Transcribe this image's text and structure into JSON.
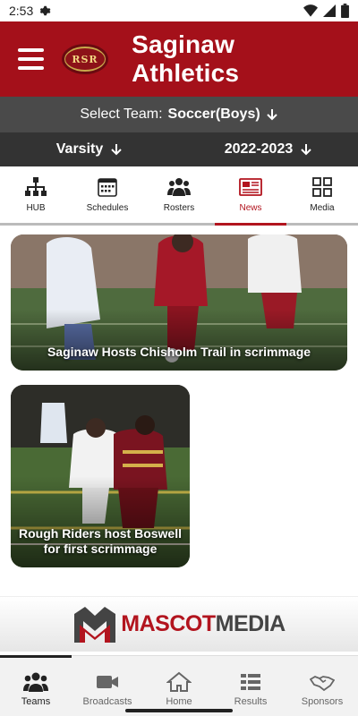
{
  "status_bar": {
    "time": "2:53"
  },
  "header": {
    "title": "Saginaw Athletics",
    "logo_text": "RSR"
  },
  "team_select": {
    "label": "Select Team:",
    "value": "Soccer(Boys)"
  },
  "level_select": {
    "level": "Varsity",
    "season": "2022-2023"
  },
  "tabs": [
    {
      "label": "HUB",
      "icon": "org-chart-icon"
    },
    {
      "label": "Schedules",
      "icon": "calendar-icon"
    },
    {
      "label": "Rosters",
      "icon": "people-icon"
    },
    {
      "label": "News",
      "icon": "newspaper-icon",
      "active": true
    },
    {
      "label": "Media",
      "icon": "grid-icon"
    }
  ],
  "news": [
    {
      "title": "Saginaw Hosts Chisholm Trail in scrimmage"
    },
    {
      "title": "Rough Riders host Boswell for first scrimmage"
    }
  ],
  "sponsor": {
    "name_part1": "MASCOT",
    "name_part2": "MEDIA"
  },
  "bottom_nav": [
    {
      "label": "Teams",
      "icon": "people-icon",
      "active": true
    },
    {
      "label": "Broadcasts",
      "icon": "video-camera-icon"
    },
    {
      "label": "Home",
      "icon": "home-icon"
    },
    {
      "label": "Results",
      "icon": "list-icon"
    },
    {
      "label": "Sponsors",
      "icon": "handshake-icon"
    }
  ],
  "colors": {
    "brand_red": "#a4101a",
    "accent_red": "#b2141e",
    "dark_gray": "#333333",
    "mid_gray": "#4a4a4a"
  }
}
